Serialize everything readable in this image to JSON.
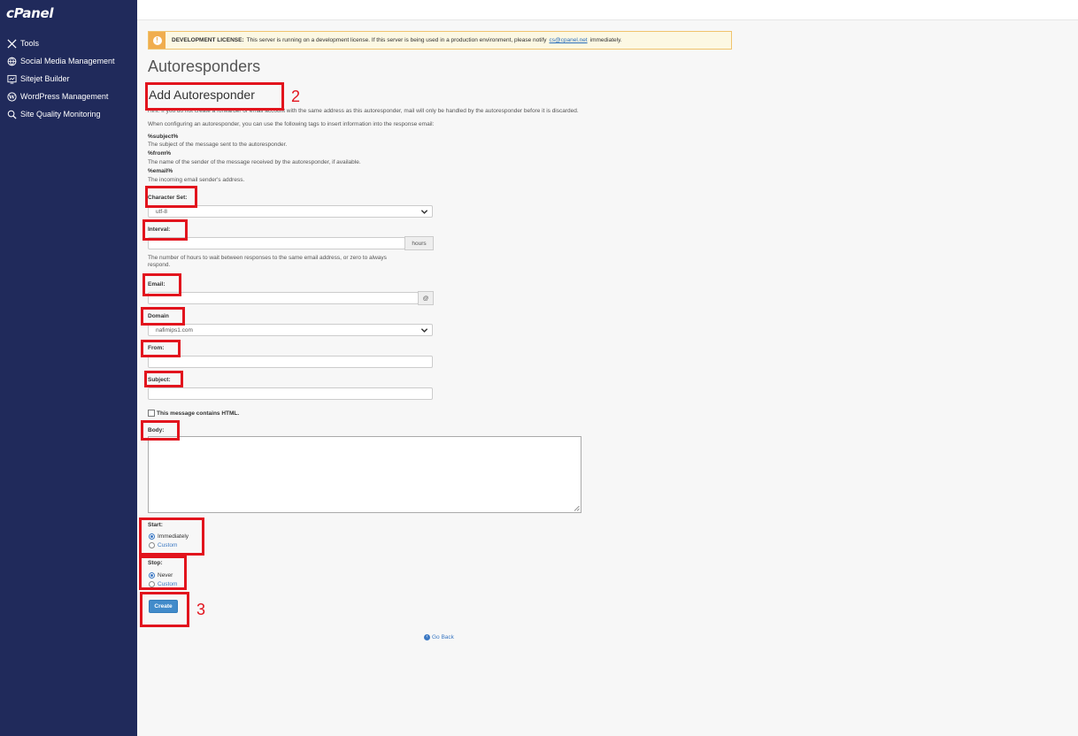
{
  "sidebar": {
    "logo": "cPanel",
    "items": [
      {
        "label": "Tools",
        "icon": "tools-icon"
      },
      {
        "label": "Social Media Management",
        "icon": "globe-icon"
      },
      {
        "label": "Sitejet Builder",
        "icon": "sitejet-icon"
      },
      {
        "label": "WordPress Management",
        "icon": "wordpress-icon"
      },
      {
        "label": "Site Quality Monitoring",
        "icon": "magnifier-icon"
      }
    ]
  },
  "alert": {
    "icon": "warning-icon",
    "title": "DEVELOPMENT LICENSE:",
    "text": "This server is running on a development license. If this server is being used in a production environment, please notify",
    "link": "cs@cpanel.net",
    "text_after": "immediately."
  },
  "page": {
    "title": "Autoresponders",
    "subtitle": "Add Autoresponder",
    "hint": "Hint: If you do not create a forwarder or email account with the same address as this autoresponder, mail will only be handled by the autoresponder before it is discarded.",
    "intro": "When configuring an autoresponder, you can use the following tags to insert information into the response email:",
    "tags": [
      {
        "tag": "%subject%",
        "desc": "The subject of the message sent to the autoresponder."
      },
      {
        "tag": "%from%",
        "desc": "The name of the sender of the message received by the autoresponder, if available."
      },
      {
        "tag": "%email%",
        "desc": "The incoming email sender's address."
      }
    ]
  },
  "form": {
    "charset_label": "Character Set:",
    "charset_value": "utf-8",
    "interval_label": "Interval:",
    "interval_value": "",
    "interval_unit": "hours",
    "interval_help_1": "The number of hours to wait between responses to the same email address, or zero to always",
    "interval_help_2": "respond.",
    "email_label": "Email:",
    "email_value": "",
    "email_addon": "@",
    "domain_label": "Domain",
    "domain_value": "nafimips1.com",
    "from_label": "From:",
    "from_value": "",
    "subject_label": "Subject:",
    "subject_value": "",
    "html_checkbox_label": "This message contains HTML.",
    "body_label": "Body:",
    "start_label": "Start:",
    "start_options": [
      "Immediately",
      "Custom"
    ],
    "stop_label": "Stop:",
    "stop_options": [
      "Never",
      "Custom"
    ],
    "create_button": "Create",
    "go_back": "Go Back"
  },
  "annotations": {
    "step_2": "2",
    "step_3": "3",
    "highlight_color": "#e2141d"
  },
  "colors": {
    "sidebar_bg": "#202a5b",
    "accent": "#428bca",
    "alert_bg": "#fcf8e3"
  }
}
